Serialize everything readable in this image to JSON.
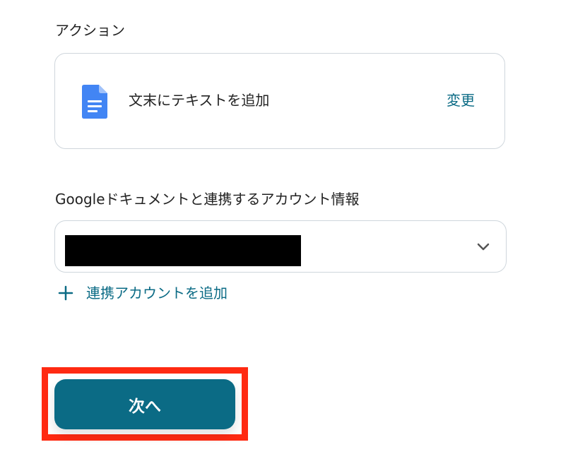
{
  "action_section": {
    "label": "アクション",
    "card": {
      "icon": "google-docs-icon",
      "name": "文末にテキストを追加",
      "change_label": "変更"
    }
  },
  "account_section": {
    "label": "Googleドキュメントと連携するアカウント情報",
    "select": {
      "value": "",
      "redacted": true,
      "icon": "chevron-down-icon"
    },
    "add_account_label": "連携アカウントを追加",
    "add_icon": "plus-icon"
  },
  "footer": {
    "next_label": "次へ",
    "highlight_color": "#ff2a12"
  },
  "colors": {
    "primary": "#0b6b85",
    "text": "#222222",
    "border": "#cfd6dc",
    "docs_blue": "#4285f4"
  }
}
